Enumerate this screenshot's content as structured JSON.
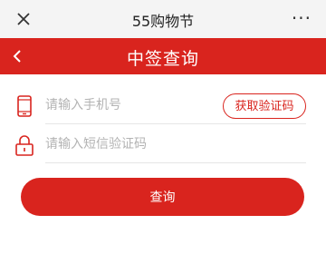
{
  "topbar": {
    "title": "55购物节",
    "close_icon": "close-icon",
    "more_label": "···"
  },
  "header": {
    "title": "中签查询",
    "back_icon": "chevron-left-icon",
    "color": "#d9241e"
  },
  "form": {
    "phone_placeholder": "请输入手机号",
    "phone_icon": "phone-icon",
    "get_code_label": "获取验证码",
    "sms_placeholder": "请输入短信验证码",
    "sms_icon": "lock-icon",
    "submit_label": "查询"
  }
}
